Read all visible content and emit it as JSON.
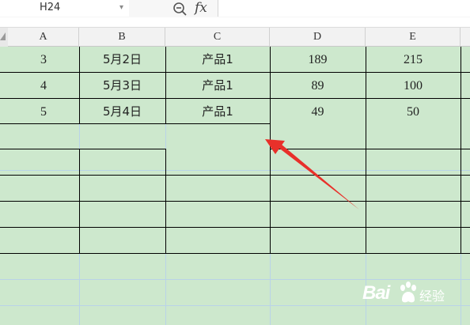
{
  "formula_bar": {
    "cell_ref": "H24",
    "dropdown_glyph": "▾",
    "fx_label": "fx",
    "zoom_icon": "zoom-search-icon",
    "formula_value": ""
  },
  "columns": [
    "A",
    "B",
    "C",
    "D",
    "E"
  ],
  "rows": [
    [
      "3",
      "5月2日",
      "产品1",
      "189",
      "215"
    ],
    [
      "4",
      "5月3日",
      "产品1",
      "89",
      "100"
    ],
    [
      "5",
      "5月4日",
      "产品1",
      "49",
      "50"
    ]
  ],
  "colors": {
    "sheet_background": "#cde8cd",
    "gridline": "#b9d3e8",
    "border": "#000000",
    "arrow": "#e8302a"
  },
  "watermark": {
    "text_a": "Bai",
    "text_b": "经验"
  }
}
